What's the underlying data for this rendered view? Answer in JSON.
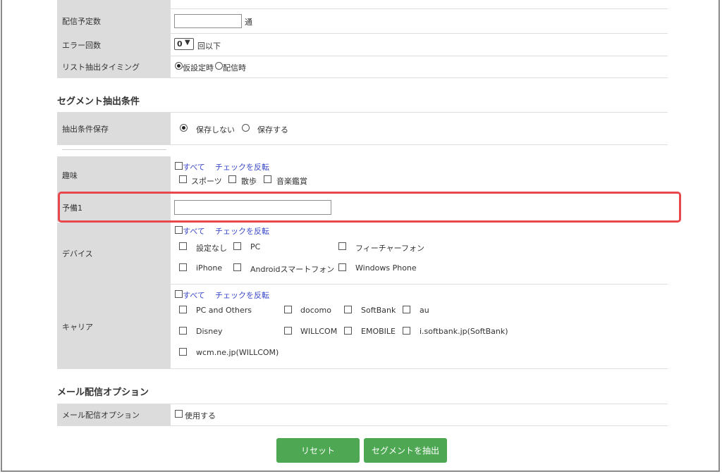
{
  "rows": {
    "delivery_count": {
      "label": "配信予定数",
      "value": "",
      "unit": "通"
    },
    "error_count": {
      "label": "エラー回数",
      "selected": "0",
      "suffix": "回以下"
    },
    "list_timing": {
      "label": "リスト抽出タイミング",
      "options": [
        "仮設定時",
        "配信時"
      ],
      "selected": "仮設定時"
    }
  },
  "segment": {
    "title": "セグメント抽出条件",
    "save": {
      "label": "抽出条件保存",
      "options": [
        "保存しない",
        "保存する"
      ],
      "selected": "保存しない"
    },
    "hobby": {
      "label": "趣味",
      "all": "すべて",
      "invert": "チェックを反転",
      "options": [
        "スポーツ",
        "散歩",
        "音楽鑑賞"
      ]
    },
    "reserve1": {
      "label": "予備1",
      "value": "",
      "highlight_color": "#e8474d"
    },
    "device": {
      "label": "デバイス",
      "all": "すべて",
      "invert": "チェックを反転",
      "options": [
        "設定なし",
        "PC",
        "フィーチャーフォン",
        "iPhone",
        "Androidスマートフォン",
        "Windows Phone"
      ]
    },
    "carrier": {
      "label": "キャリア",
      "all": "すべて",
      "invert": "チェックを反転",
      "options": [
        "PC and Others",
        "docomo",
        "SoftBank",
        "au",
        "Disney",
        "WILLCOM",
        "EMOBILE",
        "i.softbank.jp(SoftBank)",
        "wcm.ne.jp(WILLCOM)"
      ]
    }
  },
  "mail_option": {
    "title": "メール配信オプション",
    "label": "メール配信オプション",
    "checkbox_label": "使用する"
  },
  "buttons": {
    "reset": "リセット",
    "extract": "セグメントを抽出",
    "color": "#4ea753"
  }
}
